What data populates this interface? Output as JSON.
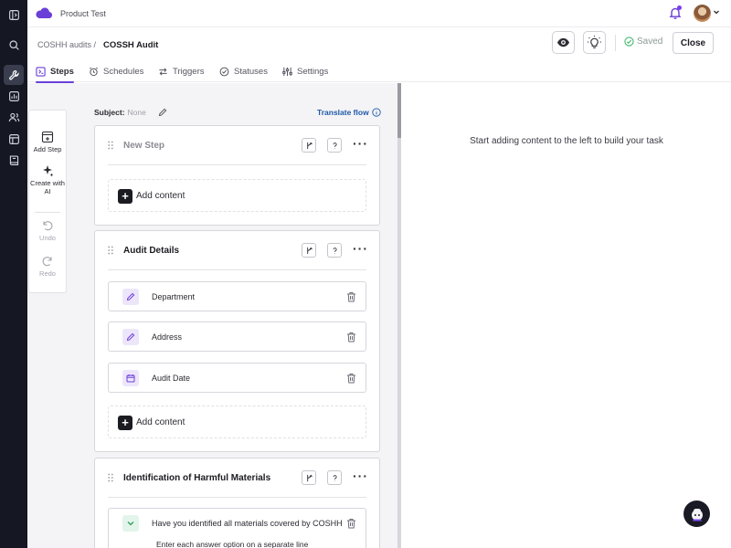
{
  "app": {
    "product_name": "Product Test"
  },
  "rail": {
    "items": [
      "panel-toggle-icon",
      "search-icon",
      "wrench-icon",
      "chart-icon",
      "users-icon",
      "layout-icon",
      "book-icon"
    ]
  },
  "header": {
    "breadcrumb": "COSHH audits /",
    "title": "COSSH Audit",
    "saved_label": "Saved",
    "close_label": "Close"
  },
  "tabs": [
    {
      "label": "Steps",
      "active": true
    },
    {
      "label": "Schedules",
      "active": false
    },
    {
      "label": "Triggers",
      "active": false
    },
    {
      "label": "Statuses",
      "active": false
    },
    {
      "label": "Settings",
      "active": false
    }
  ],
  "tools": {
    "add_step": "Add Step",
    "create_ai": "Create with AI",
    "undo": "Undo",
    "redo": "Redo"
  },
  "subject": {
    "label": "Subject:",
    "value": "None"
  },
  "translate_label": "Translate flow",
  "steps": [
    {
      "title": "New Step",
      "add_content": "Add content"
    },
    {
      "title": "Audit Details",
      "fields": [
        {
          "label": "Department",
          "icon": "pencil-icon"
        },
        {
          "label": "Address",
          "icon": "pencil-icon"
        },
        {
          "label": "Audit Date",
          "icon": "calendar-icon"
        }
      ],
      "add_content": "Add content"
    },
    {
      "title": "Identification of Harmful Materials",
      "fields": [
        {
          "label": "Have you identified all materials covered by COSHH",
          "icon": "chevron-down-icon",
          "sub": "Enter each answer option on a separate line"
        }
      ]
    }
  ],
  "right_panel": {
    "empty_message": "Start adding content to the left to build your task"
  },
  "colors": {
    "accent": "#6a3fd8",
    "rail": "#151722",
    "link": "#1f58a8"
  }
}
